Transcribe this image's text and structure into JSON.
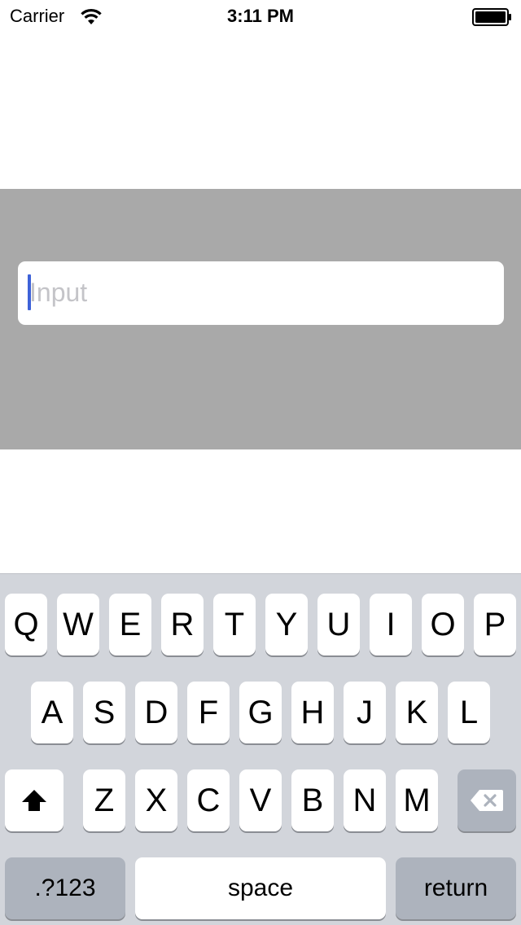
{
  "status_bar": {
    "carrier": "Carrier",
    "time": "3:11 PM",
    "wifi_icon": "wifi-icon",
    "battery_icon": "battery-icon"
  },
  "form": {
    "panel_color": "#a9a9a9",
    "input_placeholder": "Input",
    "input_value": "",
    "caret_color": "#3e62d8"
  },
  "keyboard": {
    "row1": [
      "Q",
      "W",
      "E",
      "R",
      "T",
      "Y",
      "U",
      "I",
      "O",
      "P"
    ],
    "row2": [
      "A",
      "S",
      "D",
      "F",
      "G",
      "H",
      "J",
      "K",
      "L"
    ],
    "row3": [
      "Z",
      "X",
      "C",
      "V",
      "B",
      "N",
      "M"
    ],
    "shift_icon": "shift-icon",
    "delete_icon": "delete-icon",
    "numbers_label": ".?123",
    "space_label": "space",
    "return_label": "return"
  }
}
